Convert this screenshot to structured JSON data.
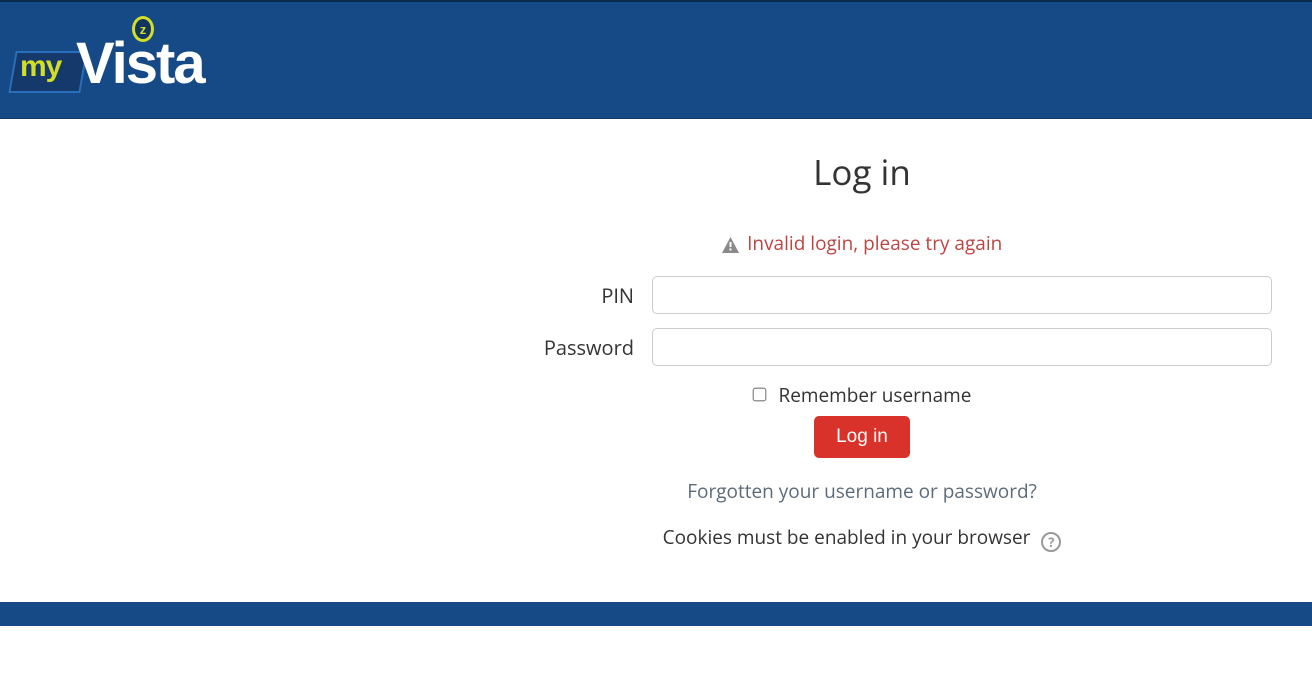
{
  "brand": {
    "my_text": "my",
    "vista_text": "Vista",
    "z_badge": "z"
  },
  "login": {
    "title": "Log in",
    "error_message": "Invalid login, please try again",
    "pin_label": "PIN",
    "password_label": "Password",
    "remember_label": "Remember username",
    "button_label": "Log in",
    "forgot_link": "Forgotten your username or password?",
    "cookies_text": "Cookies must be enabled in your browser",
    "help_glyph": "?"
  }
}
